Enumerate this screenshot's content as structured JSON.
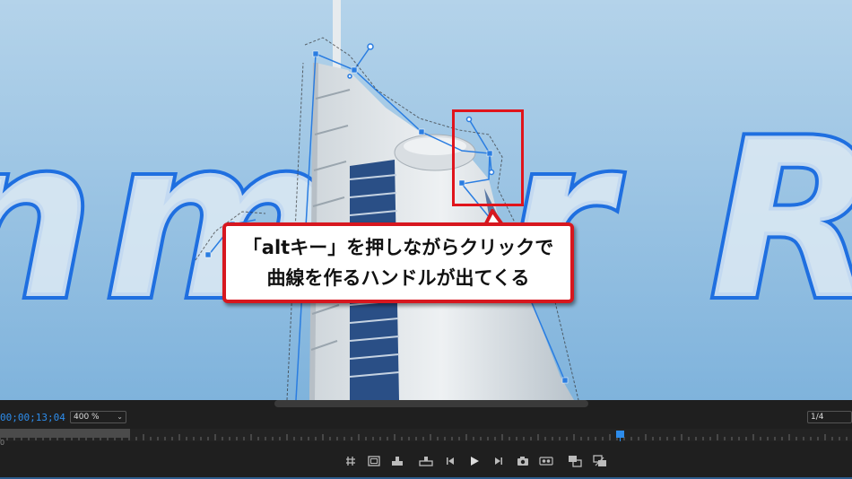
{
  "viewer": {
    "title_text": "nmar R",
    "callout": {
      "line1": "「altキー」を押しながらクリックで",
      "line2": "曲線を作るハンドルが出てくる"
    },
    "colors": {
      "accent_red": "#e0141b",
      "path_blue": "#2a7de1",
      "title_outline": "#1f6fe0"
    }
  },
  "controls": {
    "timecode": "00;00;13;04",
    "zoom": {
      "value": "400 %",
      "icon": "chevron-down-icon"
    },
    "resolution": "1/4",
    "ruler_start": "0",
    "playhead_position_fraction": 0.727,
    "transport_icons": [
      "add-marker-icon",
      "safe-margins-icon",
      "insert-icon",
      "overwrite-icon",
      "step-back-icon",
      "play-icon",
      "step-forward-icon",
      "export-frame-icon",
      "vr-video-icon",
      "compare-view-icon",
      "toggle-proxies-icon"
    ],
    "accent": "#2d8ceb"
  }
}
